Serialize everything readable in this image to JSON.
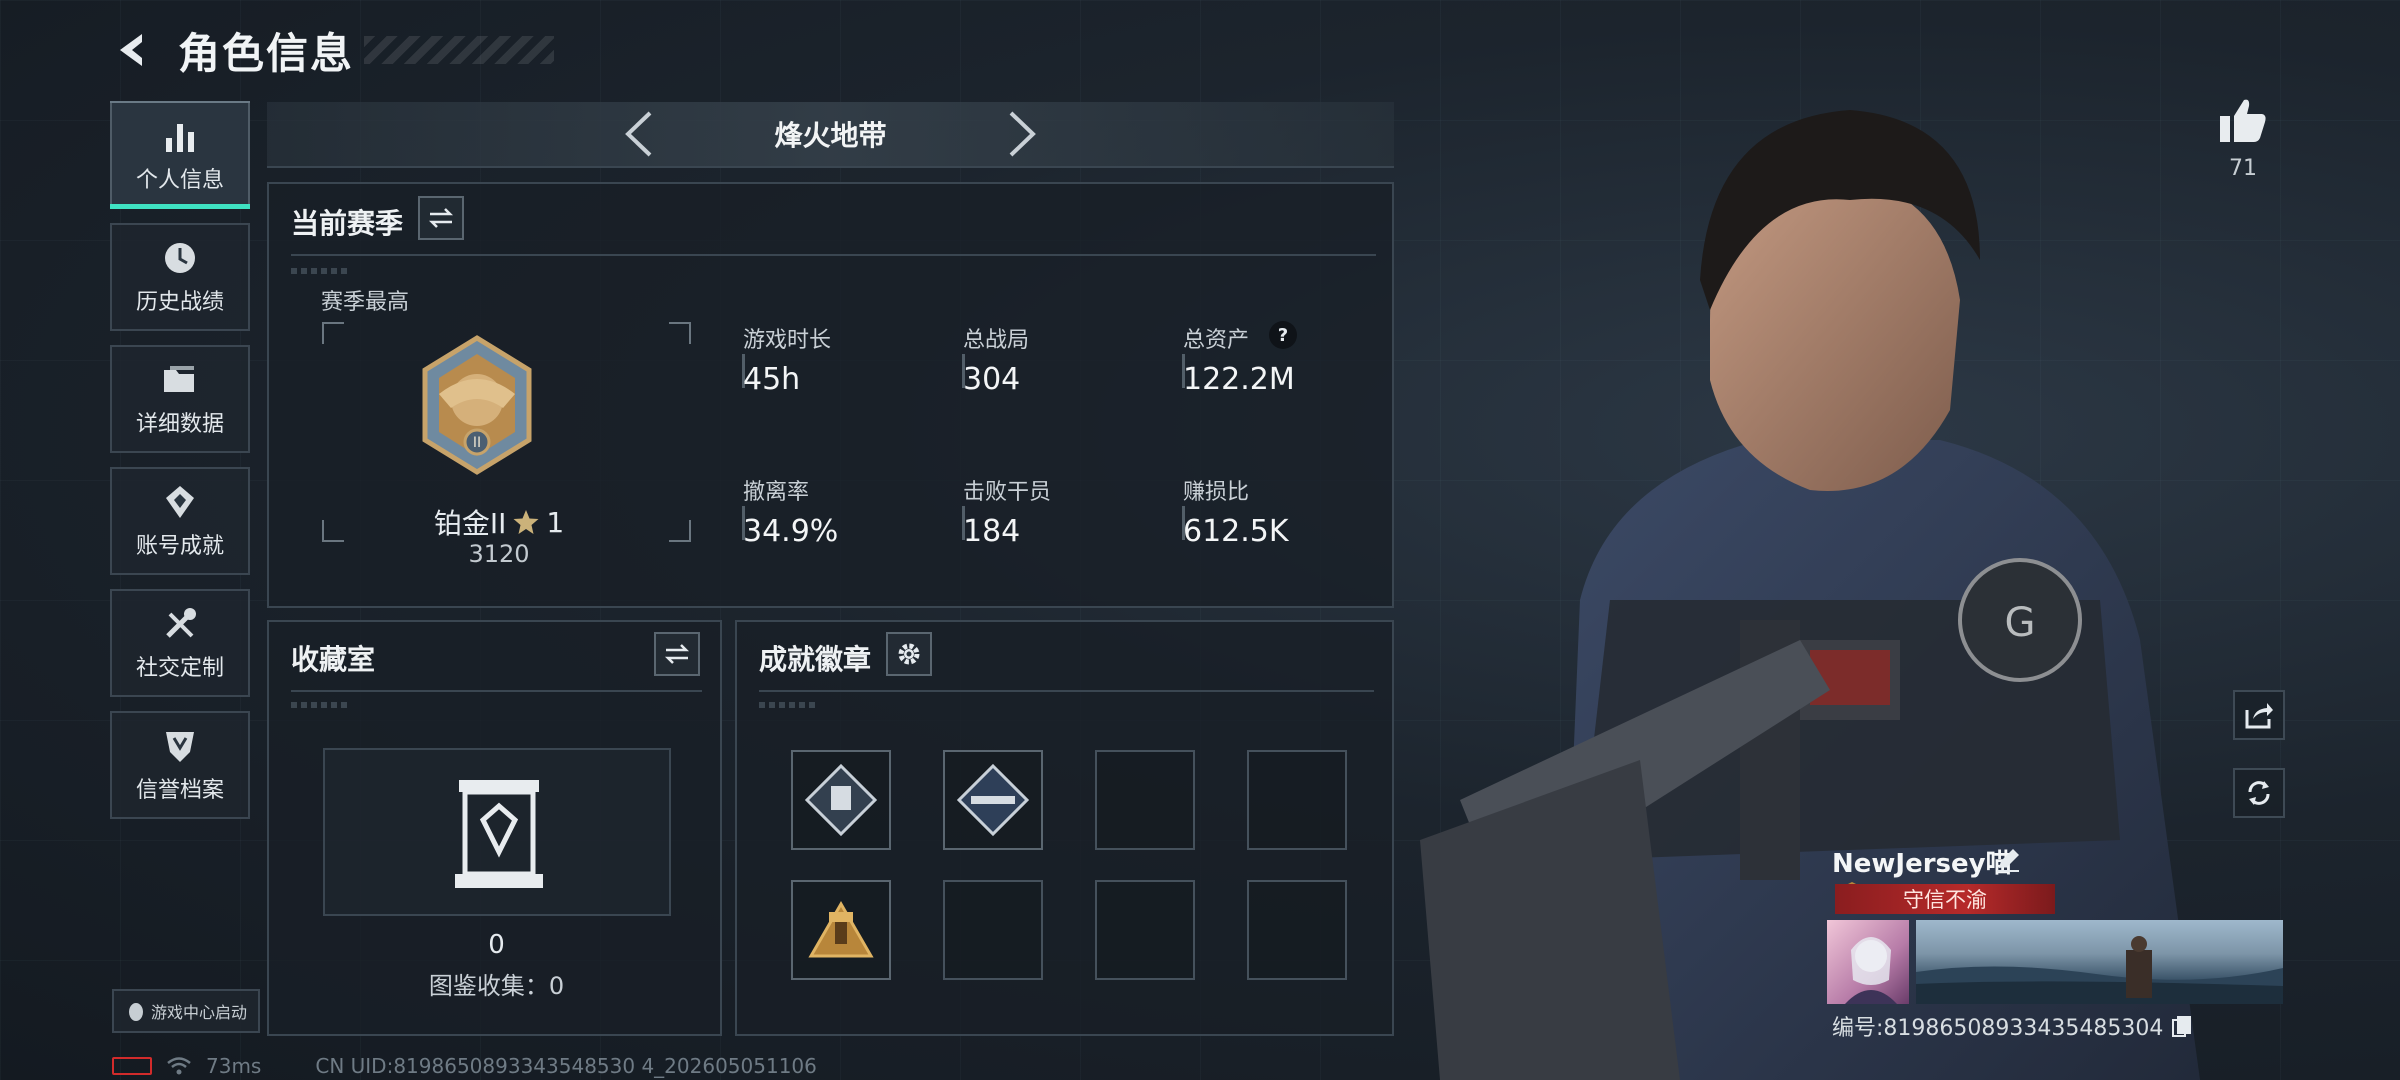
{
  "header": {
    "title": "角色信息",
    "back_icon": "chevron-left-icon"
  },
  "sidebar": {
    "items": [
      {
        "label": "个人信息",
        "icon": "bar-chart-icon",
        "active": true
      },
      {
        "label": "历史战绩",
        "icon": "history-clock-icon",
        "active": false
      },
      {
        "label": "详细数据",
        "icon": "folder-icon",
        "active": false
      },
      {
        "label": "账号成就",
        "icon": "achievement-icon",
        "active": false
      },
      {
        "label": "社交定制",
        "icon": "tools-icon",
        "active": false
      },
      {
        "label": "信誉档案",
        "icon": "shield-icon",
        "active": false
      }
    ],
    "launch_button": "游戏中心启动"
  },
  "status": {
    "ping": "73ms",
    "uid": "CN UID:8198650893343548530 4_202605051106"
  },
  "mode": {
    "name": "烽火地带"
  },
  "season": {
    "title": "当前赛季",
    "best_label": "赛季最高",
    "rank_name": "铂金II",
    "rank_stars": "1",
    "rank_points": "3120",
    "stats": [
      {
        "label": "游戏时长",
        "value": "45h"
      },
      {
        "label": "总战局",
        "value": "304"
      },
      {
        "label": "总资产",
        "value": "122.2M",
        "help": "?"
      },
      {
        "label": "撤离率",
        "value": "34.9%"
      },
      {
        "label": "击败干员",
        "value": "184"
      },
      {
        "label": "赚损比",
        "value": "612.5K"
      }
    ]
  },
  "collection": {
    "title": "收藏室",
    "count": "0",
    "catalog_label": "图鉴收集：0"
  },
  "badges": {
    "title": "成就徽章",
    "slots": [
      true,
      true,
      false,
      false,
      true,
      false,
      false,
      false
    ]
  },
  "profile": {
    "likes": "71",
    "name": "NewJersey喵",
    "title_tag": "守信不渝",
    "id_text": "编号:81986508933435485304"
  },
  "colors": {
    "accent": "#3fe3c3",
    "tag_red": "#b62a2a"
  }
}
